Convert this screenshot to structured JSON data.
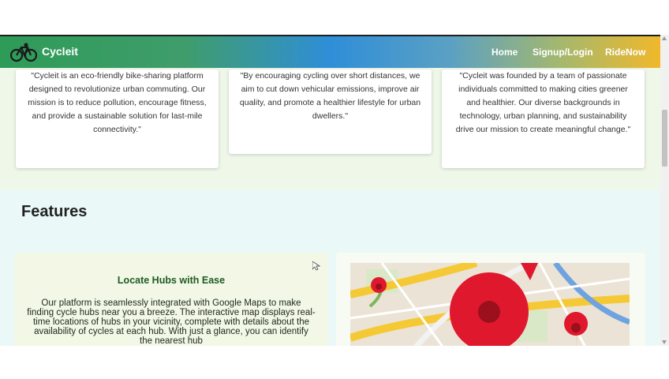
{
  "nav": {
    "brand": "Cycleit",
    "links": [
      "Home",
      "Signup/Login",
      "RideNow"
    ]
  },
  "mission_quotes": [
    "\"Cycleit is an eco-friendly bike-sharing platform designed to revolutionize urban commuting. Our mission is to reduce pollution, encourage fitness, and provide a sustainable solution for last-mile connectivity.\"",
    "\"By encouraging cycling over short distances, we aim to cut down vehicular emissions, improve air quality, and promote a healthier lifestyle for urban dwellers.\"",
    "\"Cycleit was founded by a team of passionate individuals committed to making cities greener and healthier. Our diverse backgrounds in technology, urban planning, and sustainability drive our mission to create meaningful change.\""
  ],
  "features": {
    "title": "Features",
    "cards": [
      {
        "heading": "Locate Hubs with Ease",
        "text": "Our platform is seamlessly integrated with Google Maps to make finding cycle hubs near you a breeze. The interactive map displays real-time locations of hubs in your vicinity, complete with details about the availability of cycles at each hub. With just a glance, you can identify the nearest hub"
      }
    ]
  },
  "colors": {
    "nav_gradient": [
      "#2e9b57",
      "#2f8ed8",
      "#f0b82c"
    ],
    "feature_heading": "#1e5c22",
    "map_pin": "#e0182d"
  }
}
